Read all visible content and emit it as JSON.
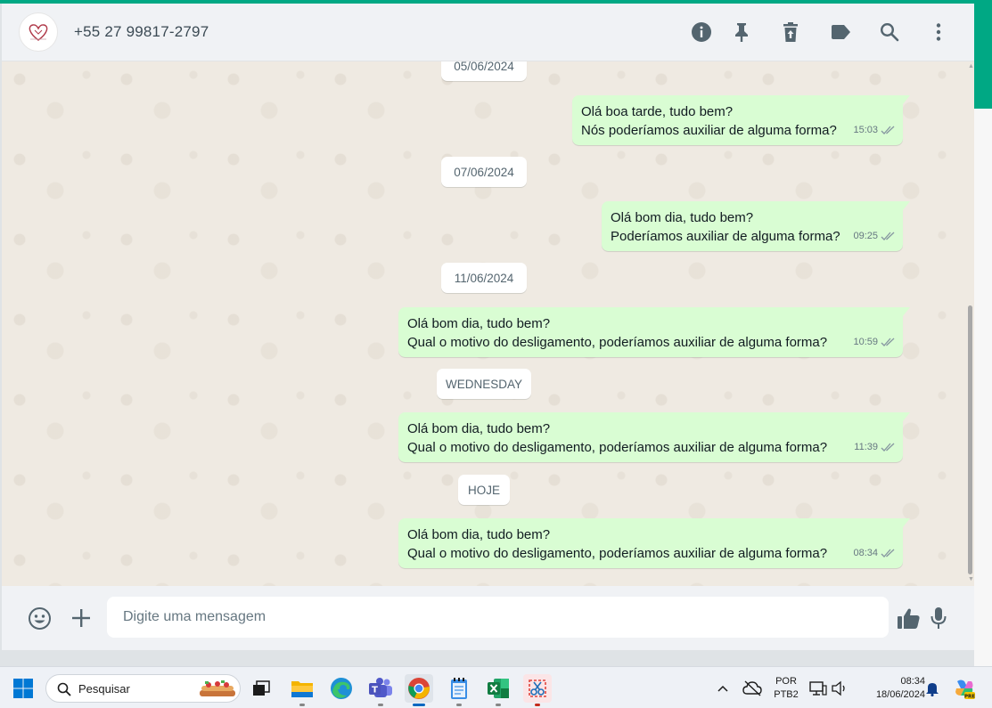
{
  "header": {
    "contact_name": "+55 27 99817-2797",
    "icons": [
      "info-icon",
      "pin-icon",
      "delete-icon",
      "label-icon",
      "search-icon",
      "more-vert-icon"
    ]
  },
  "chat": {
    "dates": [
      "05/06/2024",
      "07/06/2024",
      "11/06/2024",
      "WEDNESDAY",
      "HOJE"
    ],
    "messages": [
      {
        "lines": [
          "Olá boa tarde, tudo bem?",
          "Nós poderíamos auxiliar de alguma forma?"
        ],
        "time": "15:03",
        "status": "read"
      },
      {
        "lines": [
          "Olá bom dia, tudo bem?",
          "Poderíamos auxiliar de alguma forma?"
        ],
        "time": "09:25",
        "status": "read"
      },
      {
        "lines": [
          "Olá bom dia, tudo bem?",
          "Qual o motivo do desligamento, poderíamos auxiliar de alguma forma?"
        ],
        "time": "10:59",
        "status": "read"
      },
      {
        "lines": [
          "Olá bom dia, tudo bem?",
          "Qual o motivo do desligamento, poderíamos auxiliar de alguma forma?"
        ],
        "time": "11:39",
        "status": "read"
      },
      {
        "lines": [
          "Olá bom dia, tudo bem?",
          "Qual o motivo do desligamento, poderíamos auxiliar de alguma forma?"
        ],
        "time": "08:34",
        "status": "read"
      }
    ]
  },
  "composer": {
    "placeholder": "Digite uma mensagem",
    "icons": [
      "emoji-icon",
      "plus-icon",
      "thumbs-up-icon",
      "mic-icon"
    ]
  },
  "colors": {
    "accent": "#00a884",
    "outgoing_bubble": "#d9fdd3",
    "chat_background": "#efeae2",
    "header_background": "#f0f2f5"
  },
  "taskbar": {
    "search_label": "Pesquisar",
    "apps": [
      "windows-start-icon",
      "task-view-icon",
      "file-explorer-icon",
      "edge-icon",
      "teams-icon",
      "chrome-icon",
      "notepad-icon",
      "excel-icon",
      "snipping-tool-icon"
    ],
    "language": "POR",
    "keyboard": "PTB2",
    "time": "08:34",
    "date": "18/06/2024"
  }
}
